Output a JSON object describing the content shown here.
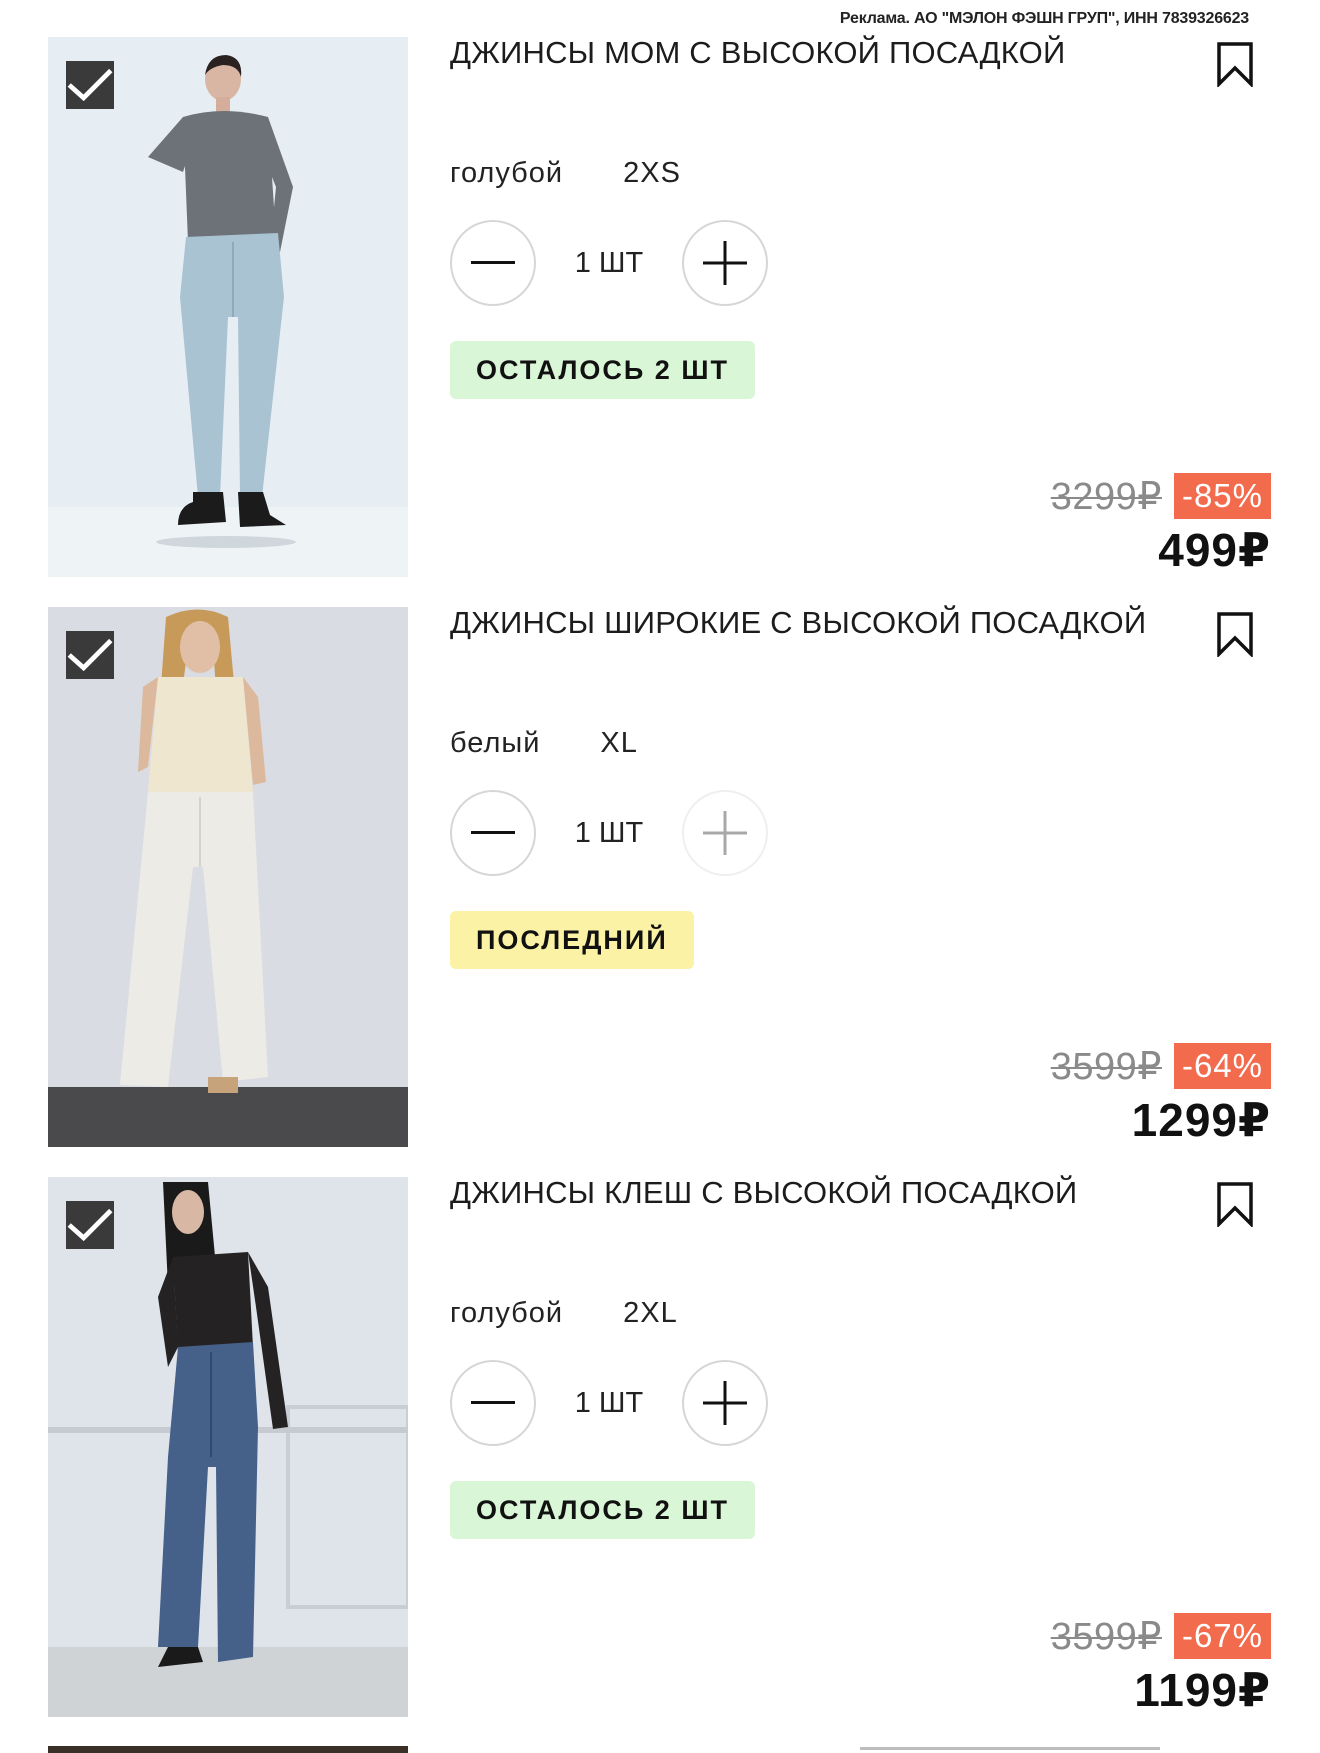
{
  "ad_label": "Реклама. АО \"МЭЛОН ФЭШН ГРУП\", ИНН 7839326623",
  "items": [
    {
      "title": "ДЖИНСЫ МОМ С ВЫСОКОЙ ПОСАДКОЙ",
      "color": "голубой",
      "size": "2XS",
      "quantity": "1 ШТ",
      "badge": "ОСТАЛОСЬ 2 ШТ",
      "badge_color": "#d9f6d6",
      "old_price": "3299₽",
      "discount": "-85%",
      "price": "499₽",
      "checked": true,
      "plus_enabled": true
    },
    {
      "title": "ДЖИНСЫ ШИРОКИЕ С ВЫСОКОЙ ПОСАДКОЙ",
      "color": "белый",
      "size": "XL",
      "quantity": "1 ШТ",
      "badge": "ПОСЛЕДНИЙ",
      "badge_color": "#fbf2a6",
      "old_price": "3599₽",
      "discount": "-64%",
      "price": "1299₽",
      "checked": true,
      "plus_enabled": false
    },
    {
      "title": "ДЖИНСЫ КЛЕШ С ВЫСОКОЙ ПОСАДКОЙ",
      "color": "голубой",
      "size": "2XL",
      "quantity": "1 ШТ",
      "badge": "ОСТАЛОСЬ 2 ШТ",
      "badge_color": "#d9f6d6",
      "old_price": "3599₽",
      "discount": "-67%",
      "price": "1199₽",
      "checked": true,
      "plus_enabled": true
    }
  ],
  "icons": {
    "check": "checkmark-icon",
    "bookmark": "bookmark-icon",
    "minus": "minus-icon",
    "plus": "plus-icon"
  },
  "colors": {
    "discount_bg": "#f36b4d",
    "check_bg": "#3a3a3a",
    "badge_green": "#d9f6d6",
    "badge_yellow": "#fbf2a6"
  }
}
